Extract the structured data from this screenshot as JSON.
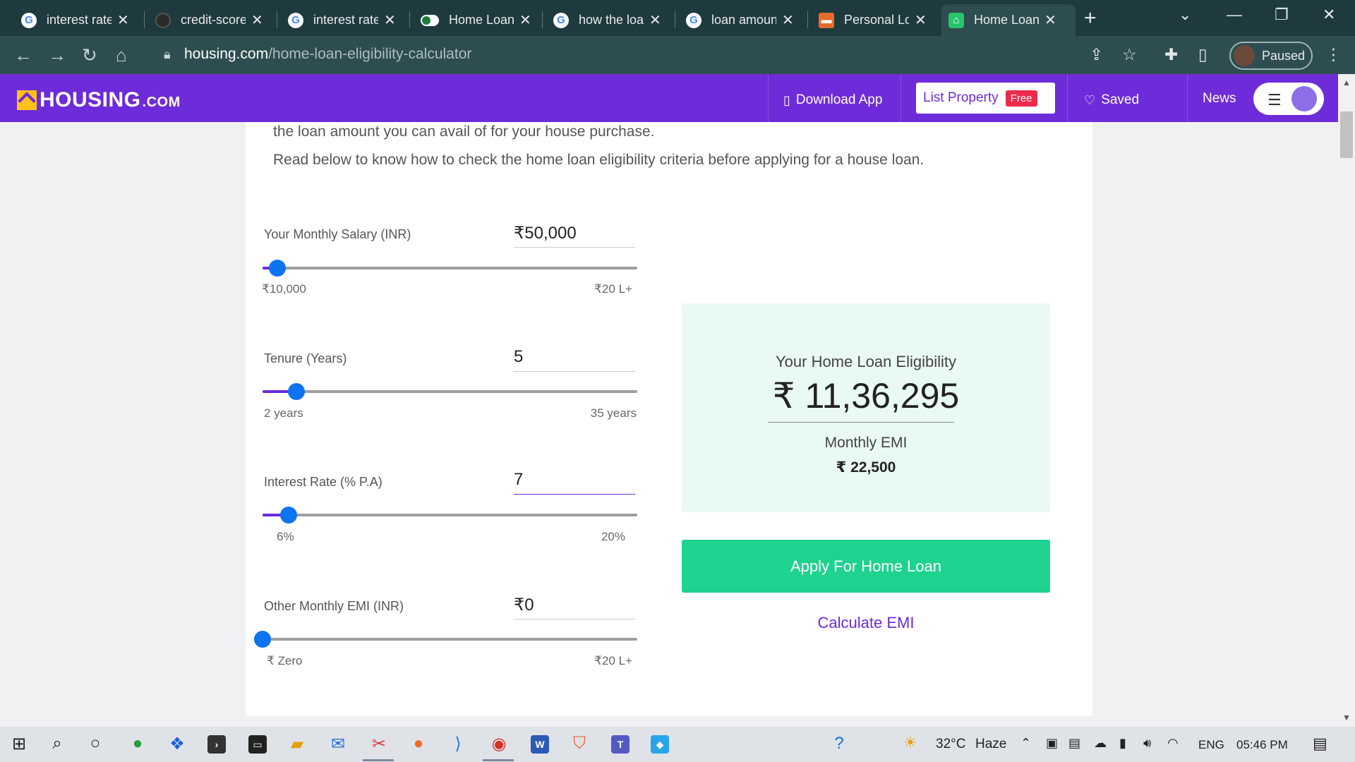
{
  "browser": {
    "tabs": [
      {
        "label": "interest rate",
        "icon": "google-icon",
        "active": false
      },
      {
        "label": "credit-score",
        "icon": "github-icon",
        "active": false
      },
      {
        "label": "interest rate",
        "icon": "google-icon",
        "active": false
      },
      {
        "label": "Home Loan",
        "icon": "toggle-icon",
        "active": false
      },
      {
        "label": "how the loan",
        "icon": "google-icon",
        "active": false
      },
      {
        "label": "loan amount",
        "icon": "google-icon",
        "active": false
      },
      {
        "label": "Personal Lo",
        "icon": "slides-icon",
        "active": false
      },
      {
        "label": "Home Loan",
        "icon": "housing-icon",
        "active": true
      }
    ],
    "url_host": "housing.com",
    "url_path": "/home-loan-eligibility-calculator",
    "profile_status": "Paused"
  },
  "site": {
    "logo_text": "HOUSING",
    "logo_suffix": ".COM",
    "download_app": "Download App",
    "list_property": "List Property",
    "free_badge": "Free",
    "saved": "Saved",
    "news": "News"
  },
  "intro": {
    "line1": "the loan amount you can avail of for your house purchase.",
    "line2": "Read below to know how to check the home loan eligibility criteria before applying for a house loan."
  },
  "calculator": {
    "salary": {
      "label": "Your Monthly Salary (INR)",
      "value": "₹50,000",
      "min": "₹10,000",
      "max": "₹20 L+",
      "level": 0.04
    },
    "tenure": {
      "label": "Tenure (Years)",
      "value": "5",
      "min": "2 years",
      "max": "35 years",
      "level": 0.09
    },
    "interest": {
      "label": "Interest Rate (% P.A)",
      "value": "7",
      "min": "6%",
      "max": "20%",
      "level": 0.07
    },
    "other_emi": {
      "label": "Other Monthly EMI (INR)",
      "value": "₹0",
      "min": "₹ Zero",
      "max": "₹20 L+",
      "level": 0.0
    }
  },
  "result": {
    "title": "Your Home Loan Eligibility",
    "amount": "₹ 11,36,295",
    "emi_label": "Monthly EMI",
    "emi_value": "₹ 22,500"
  },
  "actions": {
    "apply": "Apply For Home Loan",
    "calculate_emi": "Calculate EMI"
  },
  "taskbar": {
    "temperature": "32°C",
    "weather": "Haze",
    "language": "ENG",
    "time": "05:46 PM"
  },
  "colors": {
    "brand": "#6e2bd9",
    "accent_green": "#1ed28f",
    "slider_thumb": "#0d73f0",
    "result_bg": "#e9f9f3"
  }
}
